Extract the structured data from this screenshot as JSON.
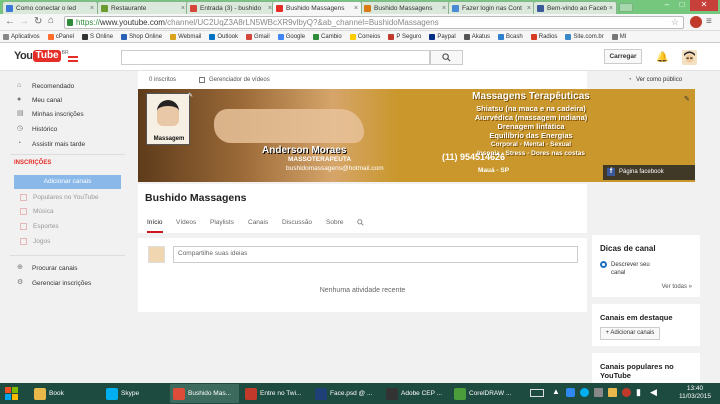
{
  "browser": {
    "tabs": [
      {
        "label": "Como conectar o led",
        "color": "#3b77d8"
      },
      {
        "label": "Restaurante",
        "color": "#6b9a2f"
      },
      {
        "label": "Entrada (3) - bushido",
        "color": "#d44638"
      },
      {
        "label": "Bushido Massagens",
        "color": "#e52d27"
      },
      {
        "label": "Bushido Massagens",
        "color": "#d97a14"
      },
      {
        "label": "Fazer login nas Cont",
        "color": "#4a8ad4"
      },
      {
        "label": "Bem-vindo ao Facebo",
        "color": "#3b5998"
      }
    ],
    "url_protocol": "https://",
    "url_host": "www.youtube.com",
    "url_path": "/channel/UC2UqZ3A8rLN5WBcXR9vlbyQ?&ab_channel=BushidoMassagens",
    "window_controls": [
      "–",
      "□",
      "✕"
    ],
    "bookmarks": [
      {
        "label": "Aplicativos",
        "color": "#888888"
      },
      {
        "label": "cPanel",
        "color": "#ff6c2c"
      },
      {
        "label": "S Online",
        "color": "#333333"
      },
      {
        "label": "Shop Online",
        "color": "#2a62b5"
      },
      {
        "label": "Webmail",
        "color": "#d8a21b"
      },
      {
        "label": "Outlook",
        "color": "#0072c6"
      },
      {
        "label": "Gmail",
        "color": "#d44638"
      },
      {
        "label": "Google",
        "color": "#4285f4"
      },
      {
        "label": "Cambio",
        "color": "#2e8b3a"
      },
      {
        "label": "Correios",
        "color": "#ffcc00"
      },
      {
        "label": "P Seguro",
        "color": "#c0392b"
      },
      {
        "label": "Paypal",
        "color": "#003087"
      },
      {
        "label": "Akatus",
        "color": "#555555"
      },
      {
        "label": "Bcash",
        "color": "#2f7fcf"
      },
      {
        "label": "Radios",
        "color": "#d63a1f"
      },
      {
        "label": "Site.com.br",
        "color": "#3a88c8"
      },
      {
        "label": "MI",
        "color": "#777777"
      }
    ]
  },
  "youtube": {
    "logo_you": "You",
    "logo_tube": "Tube",
    "region": "BR",
    "upload_label": "Carregar",
    "sidebar": {
      "items": [
        {
          "label": "Recomendado",
          "icon": "⌂"
        },
        {
          "label": "Meu canal",
          "icon": "●"
        },
        {
          "label": "Minhas inscrições",
          "icon": "▤"
        },
        {
          "label": "Histórico",
          "icon": "◷"
        },
        {
          "label": "Assistir mais tarde",
          "icon": "◔"
        }
      ],
      "subscriptions_heading": "INSCRIÇÕES",
      "add_channels": "Adicionar canais",
      "subs": [
        "Populares no YouTube",
        "Música",
        "Esportes",
        "Jogos"
      ],
      "browse": "Procurar canais",
      "manage": "Gerenciar inscrições"
    },
    "stats": {
      "subscribers": "0 inscritos",
      "manager": "Gerenciador de vídeos",
      "view_public": "Ver como público"
    },
    "banner": {
      "title": "Massagens Terapêuticas",
      "lines": [
        "Shiatsu (na maca e na cadeira)",
        "Aiurvédica (massagem indiana)",
        "Drenagem linfática",
        "Equilíbrio das Energias",
        "Corporal  -  Mental  -  Sexual",
        "Insonia  -  Stress  -  Dores nas costas"
      ],
      "name": "Anderson Moraes",
      "role": "MASSOTERAPEUTA",
      "phone": "(11) 954514626",
      "email": "bushidomassagens@hotmail.com",
      "city": "Mauá - SP",
      "logo_text": "Massagem",
      "facebook": "Página facebook"
    },
    "channel_name": "Bushido Massagens",
    "tabs": [
      "Início",
      "Vídeos",
      "Playlists",
      "Canais",
      "Discussão",
      "Sobre"
    ],
    "share_placeholder": "Compartilhe suas ideias",
    "no_activity": "Nenhuma atividade recente",
    "right": {
      "tips_title": "Dicas de canal",
      "tips_option": "Descrever seu canal",
      "see_all": "Ver todas »",
      "featured_title": "Canais em destaque",
      "add_channels": "+ Adicionar canais",
      "popular_title": "Canais populares no YouTube"
    }
  },
  "taskbar": {
    "items": [
      {
        "label": "Book",
        "color": "#e8b84a"
      },
      {
        "label": "Skype",
        "color": "#00aff0"
      },
      {
        "label": "Bushido Mas...",
        "color": "#dd4b39"
      },
      {
        "label": "Entre no Twi...",
        "color": "#c0392b"
      },
      {
        "label": "Face.psd @ ...",
        "color": "#1f3f77"
      },
      {
        "label": "Adobe CEP ...",
        "color": "#333333"
      },
      {
        "label": "CorelDRAW ...",
        "color": "#4a9d3a"
      }
    ],
    "time": "13:40",
    "date": "11/03/2015"
  }
}
